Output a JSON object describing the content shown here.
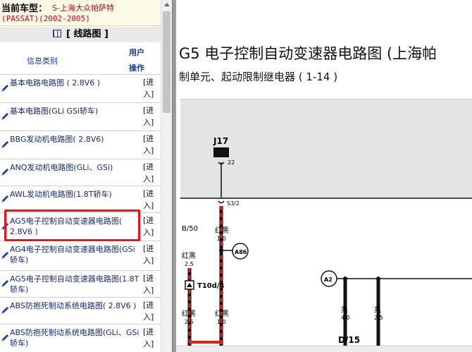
{
  "vehicle": {
    "label": "当前车型：",
    "model": "S-上海大众帕萨特",
    "model_code": "(PASSAT)(2002-2005)"
  },
  "panel": {
    "title": "[ 线路图 ]",
    "col_info": "信息类别",
    "col_op": "用户操作"
  },
  "rows": [
    {
      "text": "基本电路电路图 ( 2.8V6 )",
      "action": "[进入]"
    },
    {
      "text": "基本电路图(GLi GSi轿车)",
      "action": "[进入]"
    },
    {
      "text": "BBG发动机电路图( 2.8V6)",
      "action": "[进入]"
    },
    {
      "text": "ANQ发动机电路图(GLi、GSi)",
      "action": "[进入]"
    },
    {
      "text": "AWL发动机电路图(1.8T轿车)",
      "action": "[进入]"
    },
    {
      "text": "AG5电子控制自动变速器电路图( 2.8V6 )",
      "action": "[进入]"
    },
    {
      "text": "AG4电子控制自动变速器电路图(GSi轿车)",
      "action": "[进入]"
    },
    {
      "text": "AG5电子控制自动变速器电路图(1.8T轿车)",
      "action": "[进入]"
    },
    {
      "text": "ABS防抱死制动系统电路图( 2.8V6 )",
      "action": "[进入]"
    },
    {
      "text": "ABS防抱死制动系统电路图(GLi、GSi轿车)",
      "action": "[进入]"
    }
  ],
  "diagram": {
    "title": "G5 电子控制自动变速器电路图 (上海帕",
    "subtitle": "制单元、起动限制继电器   ( 1-14 )",
    "labels": {
      "j17": "J17",
      "j17_pin": "22",
      "s32": "S3/2",
      "b50": "B/50",
      "red_black": "红黑",
      "wire_10": "1.0",
      "wire_25": "2.5",
      "a86": "A86",
      "a2": "A2",
      "t10d": "T10d/4",
      "black": "黑",
      "wire_40": "4.0",
      "d15": "D/15"
    }
  },
  "colors": {
    "highlight": "#e8131b",
    "link_text": "#1a2a6e",
    "vehicle_value": "#d0021b"
  }
}
